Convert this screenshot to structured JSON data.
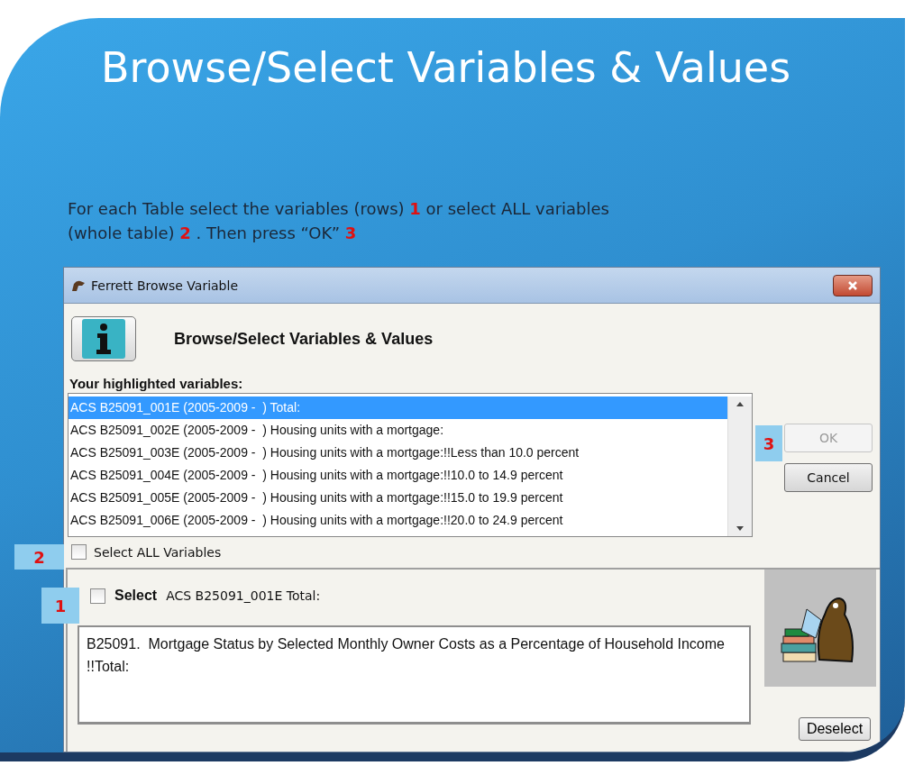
{
  "slide": {
    "title": "Browse/Select Variables & Values",
    "instruction": [
      {
        "kind": "text",
        "text": "For each Table select the variables (rows) "
      },
      {
        "kind": "marker",
        "text": "1"
      },
      {
        "kind": "text",
        "text": " or select ALL variables (whole table) "
      },
      {
        "kind": "marker",
        "text": "2"
      },
      {
        "kind": "text",
        "text": " . Then press “OK” "
      },
      {
        "kind": "marker",
        "text": "3"
      }
    ]
  },
  "dialog": {
    "title": "Ferrett Browse Variable",
    "heading": "Browse/Select Variables & Values",
    "list_label": "Your highlighted variables:",
    "variables": [
      {
        "text": "ACS B25091_001E (2005-2009 -  ) Total:",
        "selected": true
      },
      {
        "text": "ACS B25091_002E (2005-2009 -  ) Housing units with a mortgage:",
        "selected": false
      },
      {
        "text": "ACS B25091_003E (2005-2009 -  ) Housing units with a mortgage:!!Less than 10.0 percent",
        "selected": false
      },
      {
        "text": "ACS B25091_004E (2005-2009 -  ) Housing units with a mortgage:!!10.0 to 14.9 percent",
        "selected": false
      },
      {
        "text": "ACS B25091_005E (2005-2009 -  ) Housing units with a mortgage:!!15.0 to 19.9 percent",
        "selected": false
      },
      {
        "text": "ACS B25091_006E (2005-2009 -  ) Housing units with a mortgage:!!20.0 to 24.9 percent",
        "selected": false
      }
    ],
    "buttons": [
      {
        "label": "OK",
        "disabled": true,
        "callout": "3"
      },
      {
        "label": "Cancel",
        "disabled": false
      }
    ],
    "select_all": {
      "label": "Select ALL Variables",
      "checked": false,
      "callout": "2"
    },
    "select": {
      "label": "Select",
      "variable": "ACS B25091_001E Total:",
      "checked": false,
      "callout": "1"
    },
    "description": "B25091.  Mortgage Status by Selected Monthly Owner Costs as a Percentage of Household Income !!Total:",
    "deselect_button": "Deselect"
  }
}
